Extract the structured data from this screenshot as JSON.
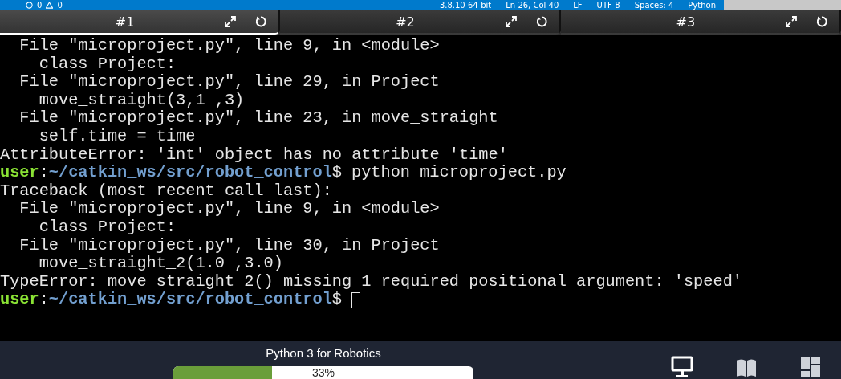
{
  "status_bar": {
    "errors": "0",
    "warnings": "0",
    "items": [
      "3.8.10 64-bit",
      "Ln 26, Col 40",
      "LF",
      "UTF-8",
      "Spaces: 4",
      "Python"
    ]
  },
  "tabs": [
    {
      "label": "#1",
      "selected": true
    },
    {
      "label": "#2",
      "selected": false
    },
    {
      "label": "#3",
      "selected": false
    }
  ],
  "terminal": {
    "lines": [
      {
        "kind": "text",
        "text": "  File \"microproject.py\", line 9, in <module>"
      },
      {
        "kind": "text",
        "text": "    class Project:"
      },
      {
        "kind": "text",
        "text": "  File \"microproject.py\", line 29, in Project"
      },
      {
        "kind": "text",
        "text": "    move_straight(3,1 ,3)"
      },
      {
        "kind": "text",
        "text": "  File \"microproject.py\", line 23, in move_straight"
      },
      {
        "kind": "text",
        "text": "    self.time = time"
      },
      {
        "kind": "text",
        "text": "AttributeError: 'int' object has no attribute 'time'"
      },
      {
        "kind": "prompt",
        "user": "user",
        "separator": ":",
        "path": "~/catkin_ws/src/robot_control",
        "symbol": "$",
        "command": "python microproject.py",
        "cursor": false
      },
      {
        "kind": "text",
        "text": "Traceback (most recent call last):"
      },
      {
        "kind": "text",
        "text": "  File \"microproject.py\", line 9, in <module>"
      },
      {
        "kind": "text",
        "text": "    class Project:"
      },
      {
        "kind": "text",
        "text": "  File \"microproject.py\", line 30, in Project"
      },
      {
        "kind": "text",
        "text": "    move_straight_2(1.0 ,3.0)"
      },
      {
        "kind": "text",
        "text": "TypeError: move_straight_2() missing 1 required positional argument: 'speed'"
      },
      {
        "kind": "prompt",
        "user": "user",
        "separator": ":",
        "path": "~/catkin_ws/src/robot_control",
        "symbol": "$",
        "cursor": true
      }
    ]
  },
  "course": {
    "title": "Python 3 for Robotics",
    "progress": {
      "level": 0.33,
      "label": "33%"
    }
  }
}
